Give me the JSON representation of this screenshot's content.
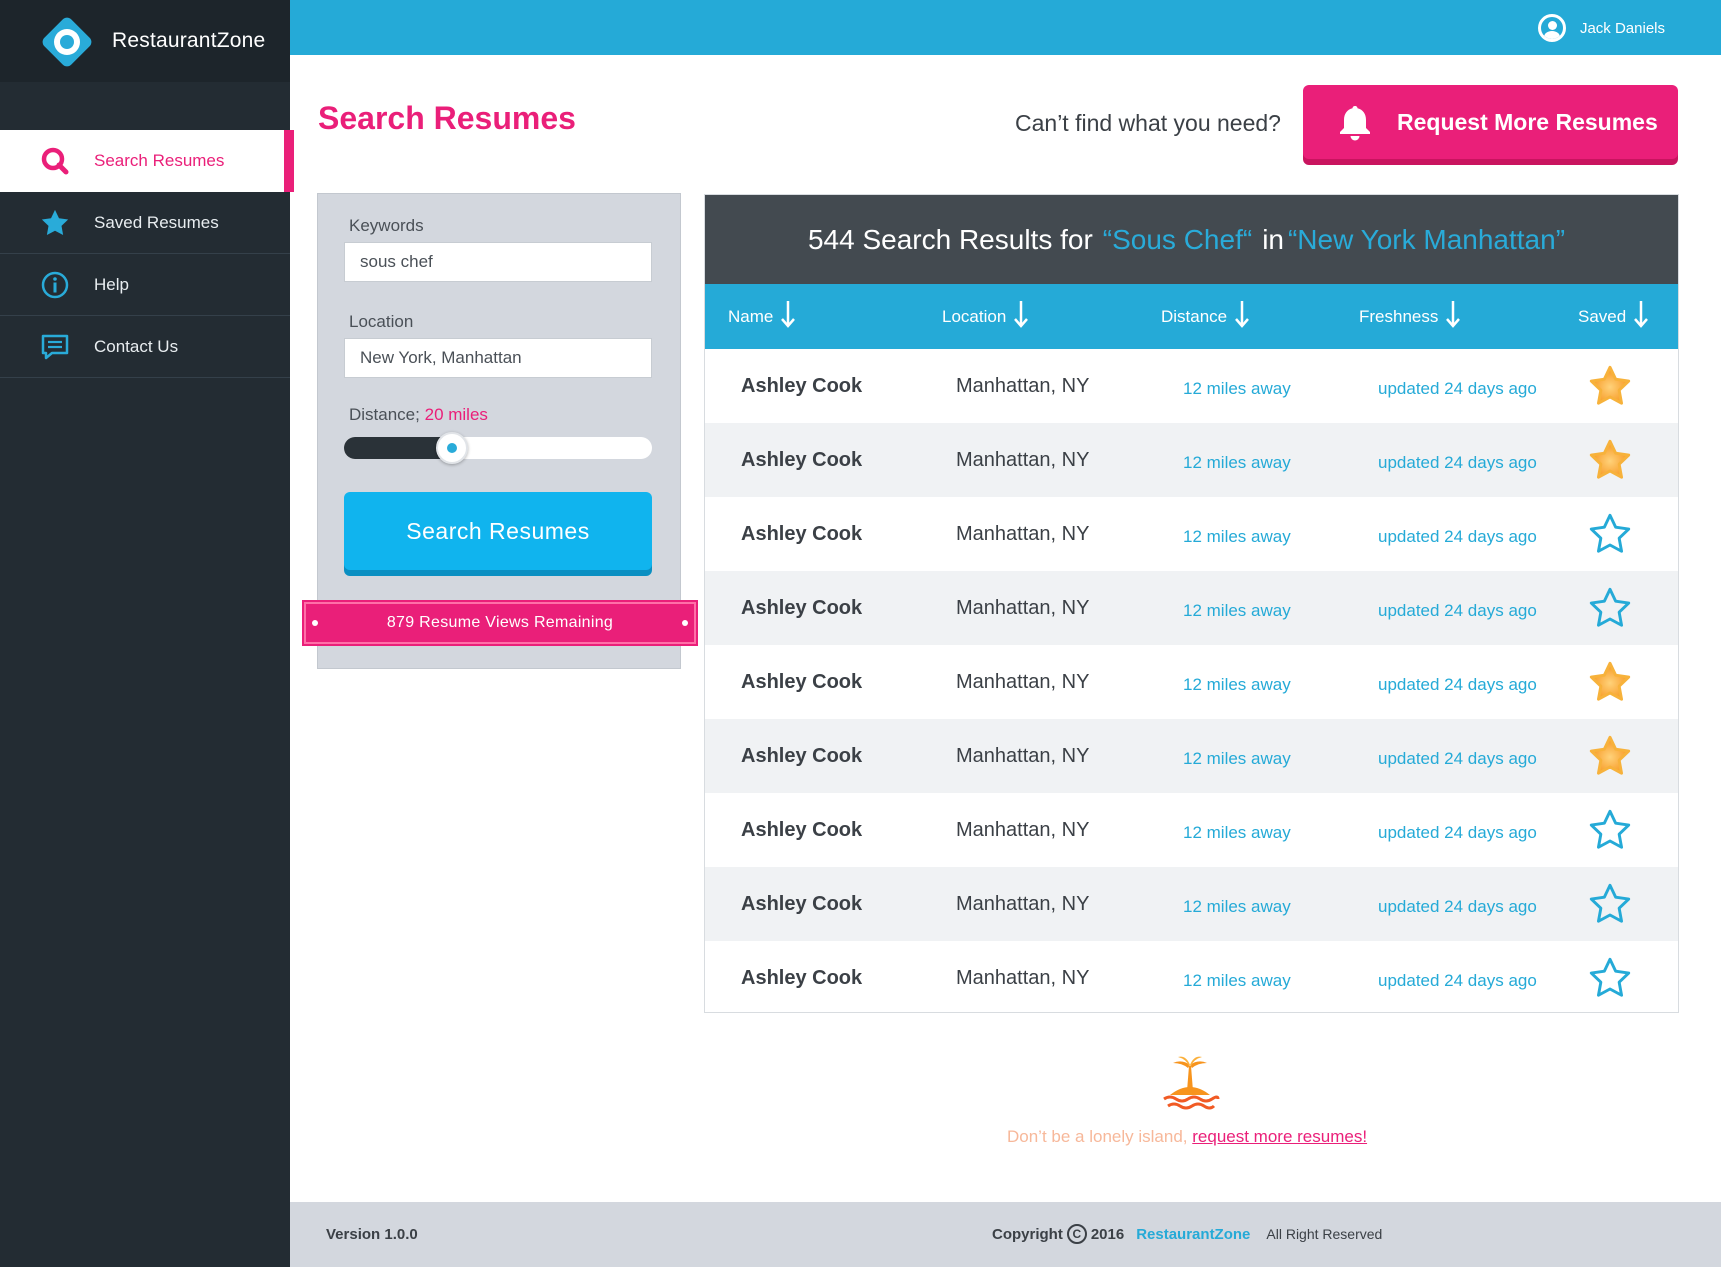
{
  "app": {
    "name": "RestaurantZone"
  },
  "user": {
    "name": "Jack Daniels"
  },
  "nav": [
    {
      "label": "Search Resumes",
      "icon": "search-icon",
      "active": true
    },
    {
      "label": "Saved Resumes",
      "icon": "star-icon",
      "active": false
    },
    {
      "label": "Help",
      "icon": "info-icon",
      "active": false
    },
    {
      "label": "Contact Us",
      "icon": "chat-icon",
      "active": false
    }
  ],
  "header": {
    "title": "Search Resumes",
    "prompt": "Can’t find what you need?",
    "request_button": "Request More Resumes"
  },
  "search": {
    "keywords_label": "Keywords",
    "keywords_value": "sous chef",
    "location_label": "Location",
    "location_value": "New York, Manhattan",
    "distance_label": "Distance;",
    "distance_value": "20 miles",
    "distance_fraction": 0.35,
    "button": "Search Resumes",
    "views_remaining": "879 Resume Views Remaining"
  },
  "results": {
    "count_text": "544 Search Results for",
    "query": "“Sous Chef“",
    "in_word": "in",
    "place": "“New York Manhattan”",
    "columns": [
      "Name",
      "Location",
      "Distance",
      "Freshness",
      "Saved"
    ],
    "rows": [
      {
        "name": "Ashley Cook",
        "location": "Manhattan, NY",
        "distance": "12 miles away",
        "freshness": "updated 24 days ago",
        "saved": true
      },
      {
        "name": "Ashley Cook",
        "location": "Manhattan, NY",
        "distance": "12 miles away",
        "freshness": "updated 24 days ago",
        "saved": true
      },
      {
        "name": "Ashley Cook",
        "location": "Manhattan, NY",
        "distance": "12 miles away",
        "freshness": "updated 24 days ago",
        "saved": false
      },
      {
        "name": "Ashley Cook",
        "location": "Manhattan, NY",
        "distance": "12 miles away",
        "freshness": "updated 24 days ago",
        "saved": false
      },
      {
        "name": "Ashley Cook",
        "location": "Manhattan, NY",
        "distance": "12 miles away",
        "freshness": "updated 24 days ago",
        "saved": true
      },
      {
        "name": "Ashley Cook",
        "location": "Manhattan, NY",
        "distance": "12 miles away",
        "freshness": "updated 24 days ago",
        "saved": true
      },
      {
        "name": "Ashley Cook",
        "location": "Manhattan, NY",
        "distance": "12 miles away",
        "freshness": "updated 24 days ago",
        "saved": false
      },
      {
        "name": "Ashley Cook",
        "location": "Manhattan, NY",
        "distance": "12 miles away",
        "freshness": "updated 24 days ago",
        "saved": false
      },
      {
        "name": "Ashley Cook",
        "location": "Manhattan, NY",
        "distance": "12 miles away",
        "freshness": "updated 24 days ago",
        "saved": false
      }
    ]
  },
  "island": {
    "text": "Don’t be a lonely island,",
    "link": "request more resumes!"
  },
  "footer": {
    "version": "Version 1.0.0",
    "copyright": "Copyright",
    "year": "2016",
    "brand": "RestaurantZone",
    "rights": "All Right Reserved"
  },
  "colors": {
    "accent_pink": "#ea1f79",
    "accent_blue": "#25aad7",
    "sidebar": "#232c33",
    "star_saved": "#f7941d",
    "star_unsaved": "#25aad7"
  }
}
